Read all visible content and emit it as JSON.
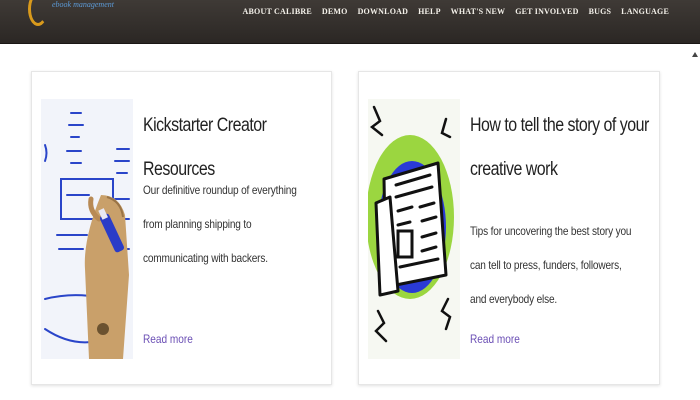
{
  "header": {
    "logo_tagline": "ebook management",
    "nav": [
      "About Calibre",
      "Demo",
      "Download",
      "Help",
      "What's New",
      "Get Involved",
      "Bugs",
      "Language"
    ]
  },
  "cards": [
    {
      "title": "Kickstarter Creator Resources",
      "description": "Our definitive roundup of everything from planning shipping to communicating with backers.",
      "link": "Read more",
      "image_icon": "whiteboard-marker-illustration"
    },
    {
      "title": "How to tell the story of your creative work",
      "description": "Tips for uncovering the best story you can tell to press, funders, followers, and everybody else.",
      "link": "Read more",
      "image_icon": "newspaper-illustration"
    }
  ],
  "colors": {
    "header_bg": "#2f2a27",
    "nav_text": "#f4f1ea",
    "link": "#6b4fb5",
    "logo_accent": "#d99a1c"
  }
}
